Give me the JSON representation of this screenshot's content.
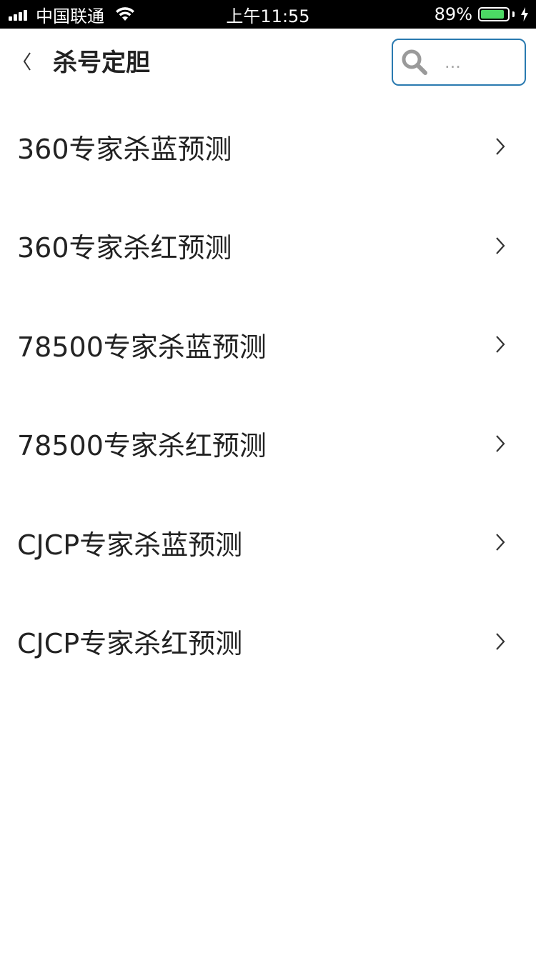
{
  "status_bar": {
    "carrier": "中国联通",
    "time": "上午11:55",
    "battery_percent": "89%",
    "battery_level": 0.89,
    "icons": [
      "signal-icon",
      "wifi-icon",
      "battery-icon",
      "charging-bolt-icon"
    ],
    "colors": {
      "background": "#000000",
      "battery_fill": "#4cd964"
    }
  },
  "nav": {
    "back_icon": "chevron-left-icon",
    "title": "杀号定胆",
    "search": {
      "icon": "search-icon",
      "placeholder": "...",
      "value": "",
      "border_color": "#2a7ab0"
    }
  },
  "list": {
    "items": [
      {
        "label": "360专家杀蓝预测",
        "icon": "chevron-right-icon"
      },
      {
        "label": "360专家杀红预测",
        "icon": "chevron-right-icon"
      },
      {
        "label": "78500专家杀蓝预测",
        "icon": "chevron-right-icon"
      },
      {
        "label": "78500专家杀红预测",
        "icon": "chevron-right-icon"
      },
      {
        "label": "CJCP专家杀蓝预测",
        "icon": "chevron-right-icon"
      },
      {
        "label": "CJCP专家杀红预测",
        "icon": "chevron-right-icon"
      }
    ]
  }
}
